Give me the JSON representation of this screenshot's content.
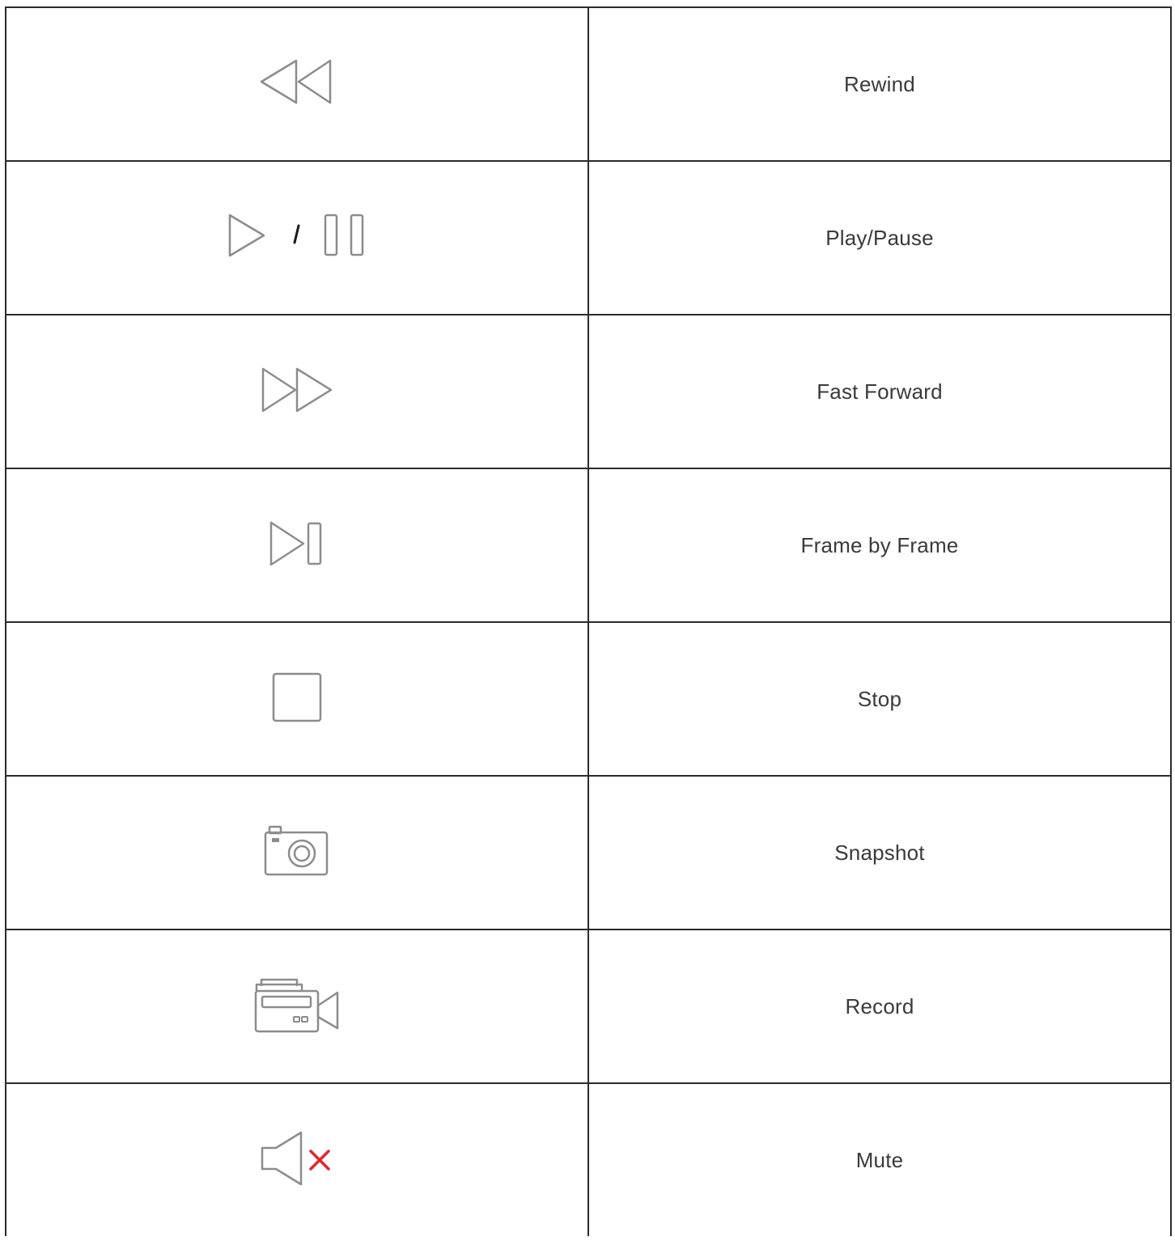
{
  "table": {
    "rows": [
      {
        "icon": "rewind-icon",
        "label": "Rewind"
      },
      {
        "icon": "play-pause-icon",
        "label": "Play/Pause"
      },
      {
        "icon": "fast-forward-icon",
        "label": "Fast Forward"
      },
      {
        "icon": "frame-by-frame-icon",
        "label": "Frame by Frame"
      },
      {
        "icon": "stop-icon",
        "label": "Stop"
      },
      {
        "icon": "snapshot-icon",
        "label": "Snapshot"
      },
      {
        "icon": "record-icon",
        "label": "Record"
      },
      {
        "icon": "mute-icon",
        "label": "Mute"
      }
    ]
  },
  "colors": {
    "icon_stroke": "#8c8c8c",
    "mute_x": "#e0262c",
    "border": "#2b2b2b",
    "label_text": "#3a3a3a"
  }
}
